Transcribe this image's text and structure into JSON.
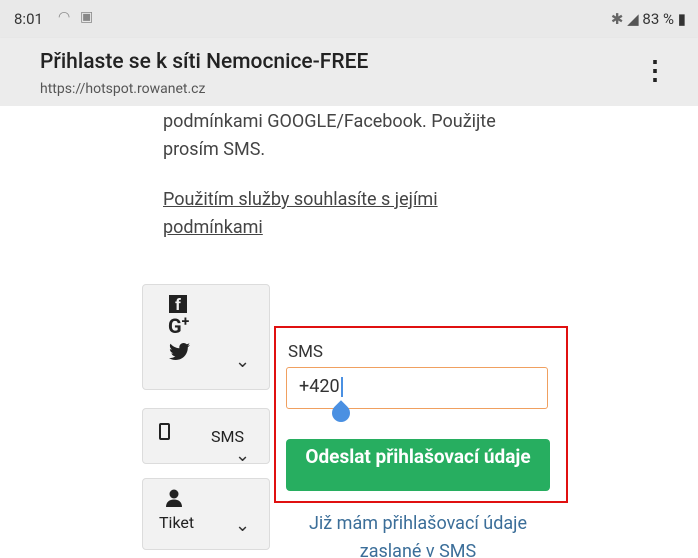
{
  "status": {
    "time": "8:01",
    "battery": "83 %"
  },
  "header": {
    "title": "Přihlaste se k síti Nemocnice-FREE",
    "url": "https://hotspot.rowanet.cz",
    "menu_icon": "⋮"
  },
  "content": {
    "para1_line1": "podmínkami GOOGLE/Facebook. Použijte",
    "para1_line2": "prosím SMS.",
    "terms_line1": "Použitím služby souhlasíte s jejími",
    "terms_line2": "podmínkami"
  },
  "login": {
    "social_tile": {
      "icons": [
        "f",
        "G+",
        "twitter"
      ]
    },
    "sms_tile": {
      "label": "SMS"
    },
    "ticket_tile": {
      "label": "Tiket"
    }
  },
  "sms_form": {
    "label": "SMS",
    "phone_value": "+420",
    "send_label": "Odeslat přihlašovací údaje",
    "already_line1": "Již mám přihlašovací údaje",
    "already_line2": "zaslané v SMS"
  }
}
